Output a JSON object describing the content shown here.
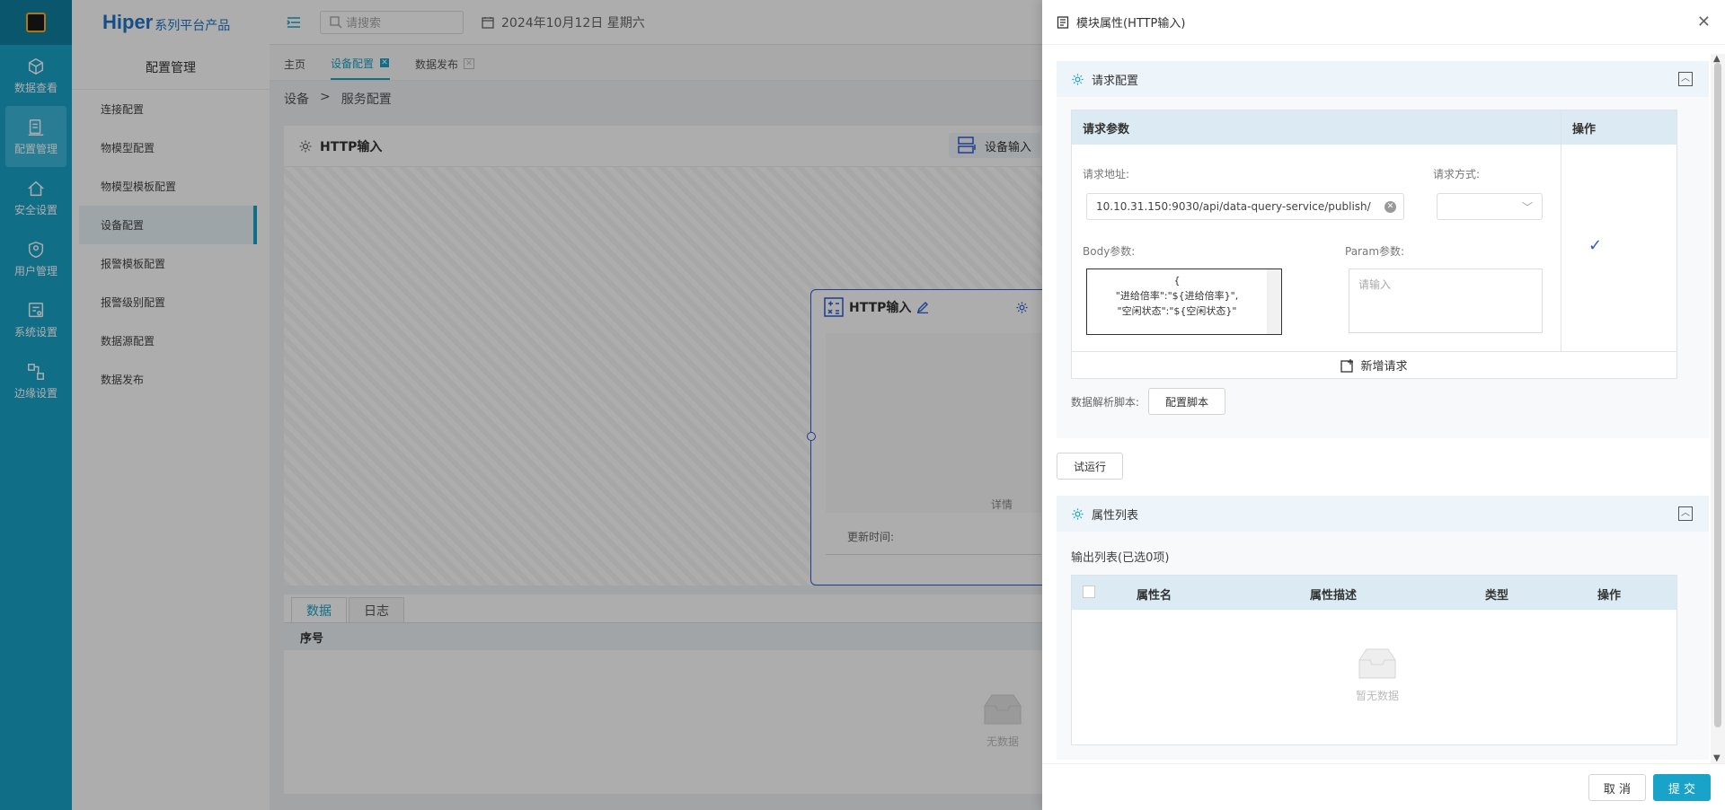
{
  "iconbar": {
    "items": [
      {
        "label": "数据查看",
        "icon": "cube-icon"
      },
      {
        "label": "配置管理",
        "icon": "config-icon"
      },
      {
        "label": "安全设置",
        "icon": "home-shield-icon"
      },
      {
        "label": "用户管理",
        "icon": "user-shield-icon"
      },
      {
        "label": "系统设置",
        "icon": "system-settings-icon"
      },
      {
        "label": "边缘设置",
        "icon": "edge-settings-icon"
      }
    ]
  },
  "brand": {
    "name": "Hiper",
    "subtitle": "系列平台产品"
  },
  "sidebar": {
    "title": "配置管理",
    "items": [
      "连接配置",
      "物模型配置",
      "物模型模板配置",
      "设备配置",
      "报警模板配置",
      "报警级别配置",
      "数据源配置",
      "数据发布"
    ]
  },
  "topbar": {
    "search_placeholder": "请搜索",
    "date": "2024年10月12日 星期六"
  },
  "tabs": [
    {
      "label": "主页"
    },
    {
      "label": "设备配置"
    },
    {
      "label": "数据发布"
    }
  ],
  "breadcrumb": {
    "root": "设备",
    "sep": ">",
    "current": "服务配置"
  },
  "main": {
    "title": "HTTP输入",
    "device_input_button": "设备输入",
    "node": {
      "title": "HTTP输入",
      "detail": "详情",
      "updated_label": "更新时间:"
    }
  },
  "bottom": {
    "tab_data": "数据",
    "tab_log": "日志",
    "col_index": "序号",
    "empty": "无数据"
  },
  "drawer": {
    "title": "模块属性(HTTP输入)",
    "request_section": {
      "title": "请求配置",
      "col_params": "请求参数",
      "col_actions": "操作",
      "url_label": "请求地址:",
      "url_value": "10.10.31.150:9030/api/data-query-service/publish/",
      "method_label": "请求方式:",
      "body_label": "Body参数:",
      "body_lines": [
        "{",
        "\"进给倍率\":\"${进给倍率}\",",
        "\"空闲状态\":\"${空闲状态}\""
      ],
      "param_label": "Param参数:",
      "param_placeholder": "请输入",
      "add_request": "新增请求",
      "script_label": "数据解析脚本:",
      "script_button": "配置脚本"
    },
    "trial_button": "试运行",
    "props_section": {
      "title": "属性列表",
      "output_label": "输出列表(已选0项)",
      "cols": [
        "属性名",
        "属性描述",
        "类型",
        "操作"
      ],
      "empty": "暂无数据"
    },
    "cancel": "取 消",
    "submit": "提 交"
  }
}
